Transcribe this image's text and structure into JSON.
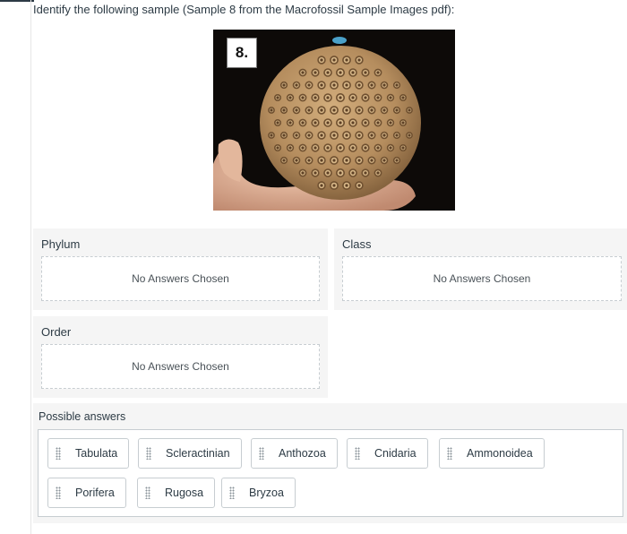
{
  "question": {
    "text": "Identify the following sample (Sample 8 from the Macrofossil Sample Images pdf):"
  },
  "image": {
    "label": "8.",
    "subject": "fossil-coral-specimen-in-hand",
    "colors": {
      "background": "#0d0a08",
      "fossil": "#b58d5e",
      "hand": "#e0b49a"
    }
  },
  "categories": [
    {
      "title": "Phylum",
      "placeholder": "No Answers Chosen"
    },
    {
      "title": "Class",
      "placeholder": "No Answers Chosen"
    },
    {
      "title": "Order",
      "placeholder": "No Answers Chosen"
    }
  ],
  "possible_answers": {
    "title": "Possible answers",
    "items": [
      "Tabulata",
      "Scleractinian",
      "Anthozoa",
      "Cnidaria",
      "Ammonoidea",
      "Porifera",
      "Rugosa",
      "Bryzoa"
    ]
  },
  "colors": {
    "panel_bg": "#f5f5f5",
    "border": "#c7cdd1",
    "text": "#2d3b45"
  }
}
